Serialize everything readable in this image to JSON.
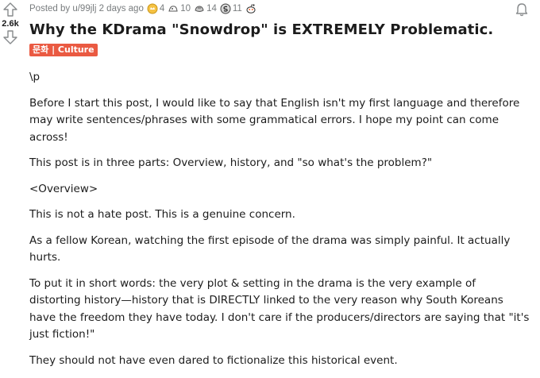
{
  "vote": {
    "score": "2.6k"
  },
  "post": {
    "meta": {
      "posted_by": "Posted by u/99jlj 2 days ago",
      "awards": [
        {
          "icon": "gold-award-icon",
          "count": "4"
        },
        {
          "icon": "helpful-award-icon",
          "count": "10"
        },
        {
          "icon": "wholesome-award-icon",
          "count": "14"
        },
        {
          "icon": "silver-coin-award-icon",
          "count": "11"
        },
        {
          "icon": "snoo-award-icon",
          "count": ""
        }
      ]
    },
    "title": "Why the KDrama \"Snowdrop\" is EXTREMELY Problematic.",
    "flair": "문화 | Culture",
    "body": [
      "\\p",
      "Before I start this post, I would like to say that English isn't my first language and therefore may write sentences/phrases with some grammatical errors. I hope my point can come across!",
      "This post is in three parts: Overview, history, and \"so what's the problem?\"",
      "<Overview>",
      "This is not a hate post. This is a genuine concern.",
      "As a fellow Korean, watching the first episode of the drama was simply painful. It actually hurts.",
      "To put it in short words: the very plot & setting in the drama is the very example of distorting history—history that is DIRECTLY linked to the very reason why South Koreans have the freedom they have today. I don't care if the producers/directors are saying that \"it's just fiction!\"",
      "They should not have even dared to fictionalize this historical event."
    ]
  },
  "colors": {
    "flair_bg": "#ea5a42",
    "meta_text": "#787c7e",
    "text": "#1c1c1c"
  }
}
